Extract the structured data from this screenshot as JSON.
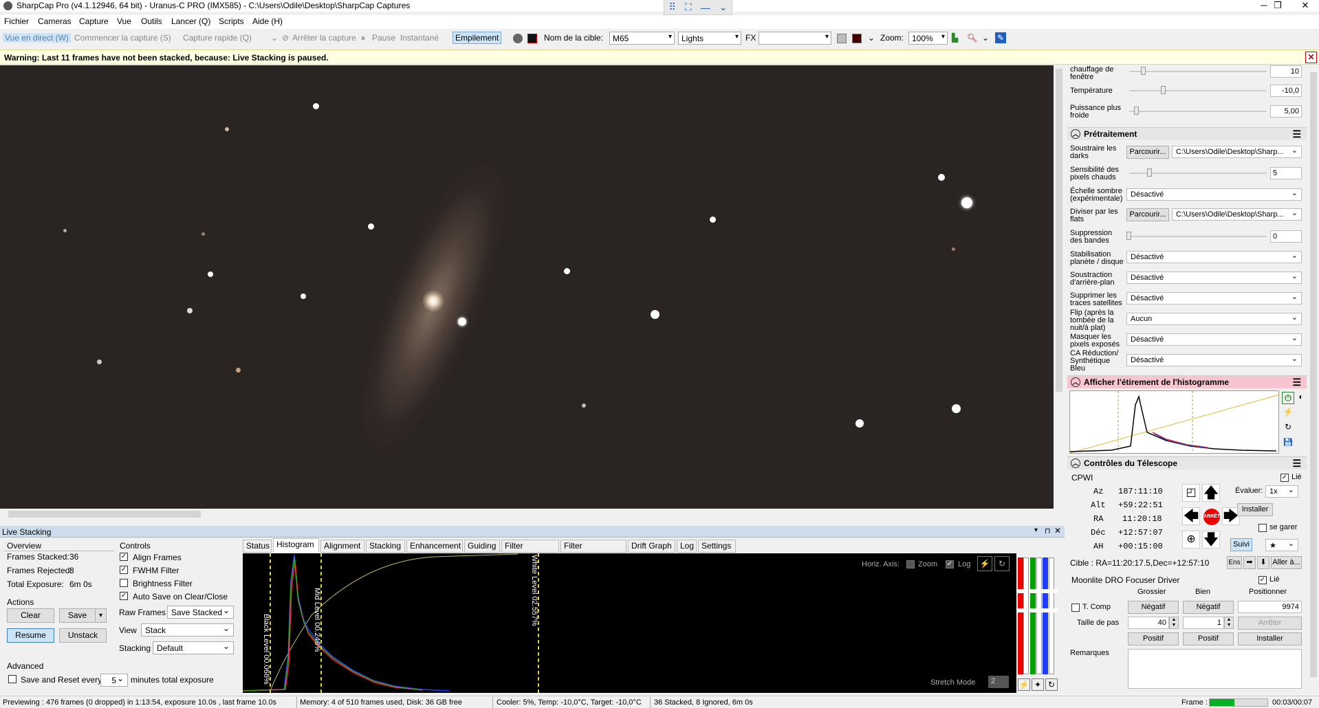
{
  "window": {
    "title": "SharpCap Pro (v4.1.12946, 64 bit) - Uranus-C PRO (IMX585) - C:\\Users\\Odile\\Desktop\\SharpCap Captures"
  },
  "menu": [
    "Fichier",
    "Cameras",
    "Capture",
    "Vue",
    "Outils",
    "Lancer (Q)",
    "Scripts",
    "Aide (H)"
  ],
  "toolbar": {
    "live": "Vue en direct (W)",
    "start": "Commencer la capture (S)",
    "quick": "Capture rapide (Q)",
    "stop": "Arrêter la capture",
    "pause": "Pause",
    "snapshot": "Instantané",
    "stacking": "Empilement",
    "target_label": "Nom de la cible:",
    "target": "M65",
    "frame_type": "Lights",
    "fx": "FX",
    "zoom_label": "Zoom:",
    "zoom": "100%"
  },
  "warning": "Warning: Last 11 frames have not been stacked, because: Live Stacking is paused.",
  "right": {
    "chauffage": "chauffage de fenêtre",
    "chauffage_val": "10",
    "temperature": "Température",
    "temperature_val": "-10,0",
    "puissance": "Puissance plus froide",
    "puissance_val": "5,00",
    "pretraitement": "Prétraitement",
    "darks": "Soustraire les darks",
    "browse": "Parcourir...",
    "darks_path": "C:\\Users\\Odile\\Desktop\\Sharp...",
    "sensibilite": "Sensibilité des pixels chauds",
    "sensibilite_val": "5",
    "echelle": "Échelle sombre (expérimentale)",
    "echelle_val": "Désactivé",
    "flats": "Diviser par les flats",
    "flats_path": "C:\\Users\\Odile\\Desktop\\Sharp...",
    "bandes": "Suppression des bandes",
    "bandes_val": "0",
    "stab": "Stabilisation planète / disque",
    "stab_val": "Désactivé",
    "arriere": "Soustraction d'arrière-plan",
    "arriere_val": "Désactivé",
    "satellites": "Supprimer les traces satellites",
    "satellites_val": "Désactivé",
    "flip": "Flip (après la tombée de la nuit/à plat)",
    "flip_val": "Aucun",
    "masquer": "Masquer les pixels exposés",
    "masquer_val": "Désactivé",
    "ca": "CA Réduction/ Synthétique Bleu",
    "ca_val": "Désactivé",
    "histo_title": "Afficher l'étirement de l'histogramme",
    "tele_title": "Contrôles du Télescope",
    "mount": "CPWI",
    "lie": "Lié",
    "az_l": "Az",
    "az": "187:11:10",
    "alt_l": "Alt",
    "alt": "+59:22:51",
    "ra_l": "RA",
    "ra": "11:20:18",
    "dec_l": "Déc",
    "dec": "+12:57:07",
    "ah_l": "AH",
    "ah": "+00:15:00",
    "evaluer": "Évaluer:",
    "rate": "1x",
    "installer": "Installer",
    "garer": "se garer",
    "arret": "ARRÊTE",
    "suivi": "Suivi",
    "cible": "Cible : RA=11:20:17.5,Dec=+12:57:10",
    "ens": "Ens",
    "aller": "Aller à...",
    "focuser": "Moonlite DRO Focuser Driver",
    "grossier": "Grossier",
    "bien": "Bien",
    "positionner": "Positionner",
    "tcomp": "T. Comp",
    "negatif": "Négatif",
    "pos_val": "9974",
    "taille": "Taille de pas",
    "taille_g": "40",
    "taille_b": "1",
    "arreter": "Arrêter",
    "positif": "Positif",
    "remarques": "Remarques"
  },
  "live": {
    "title": "Live Stacking",
    "overview": "Overview",
    "stacked_l": "Frames Stacked:",
    "stacked": "36",
    "rejected_l": "Frames Rejected:",
    "rejected": "8",
    "exposure_l": "Total Exposure:",
    "exposure": "6m 0s",
    "actions": "Actions",
    "clear": "Clear",
    "save": "Save",
    "resume": "Resume",
    "unstack": "Unstack",
    "advanced": "Advanced",
    "reset_l": "Save and Reset every",
    "reset_val": "5",
    "reset_tail": "minutes total exposure",
    "controls": "Controls",
    "align": "Align Frames",
    "fwhm": "FWHM Filter",
    "bright": "Brightness Filter",
    "autosave": "Auto Save on Clear/Close",
    "raw_l": "Raw Frames",
    "raw": "Save Stacked",
    "view_l": "View",
    "view": "Stack",
    "stacking_l": "Stacking",
    "stacking": "Default",
    "tabs": [
      "Status",
      "Histogram",
      "Alignment",
      "Stacking",
      "Enhancement",
      "Guiding",
      "Filter (FWHM)",
      "Filter (Brightness)",
      "Drift Graph",
      "Log",
      "Settings"
    ],
    "horiz": "Horiz. Axis:",
    "zoom": "Zoom",
    "log": "Log",
    "stretch": "Stretch Mode",
    "stretch_val": "2",
    "black": "Black Level 00.066%",
    "mid": "Mid Level 00.246%",
    "white": "White Level 02.557%"
  },
  "status": {
    "preview": "Previewing : 476 frames (0 dropped) in 1:13:54, exposure 10.0s , last frame 10.0s",
    "memory": "Memory: 4 of 510 frames used, Disk: 36 GB free",
    "cooler": "Cooler: 5%, Temp: -10,0°C, Target: -10,0°C",
    "stacked": "36 Stacked, 8 Ignored, 6m 0s",
    "frame": "Frame :",
    "time": "00:03/00:07"
  },
  "colors": {
    "accent": "#1f5fbf",
    "warning_bg": "#ffffe1",
    "histo_head": "#f7c4d0",
    "active_tab": "#ffffff"
  }
}
